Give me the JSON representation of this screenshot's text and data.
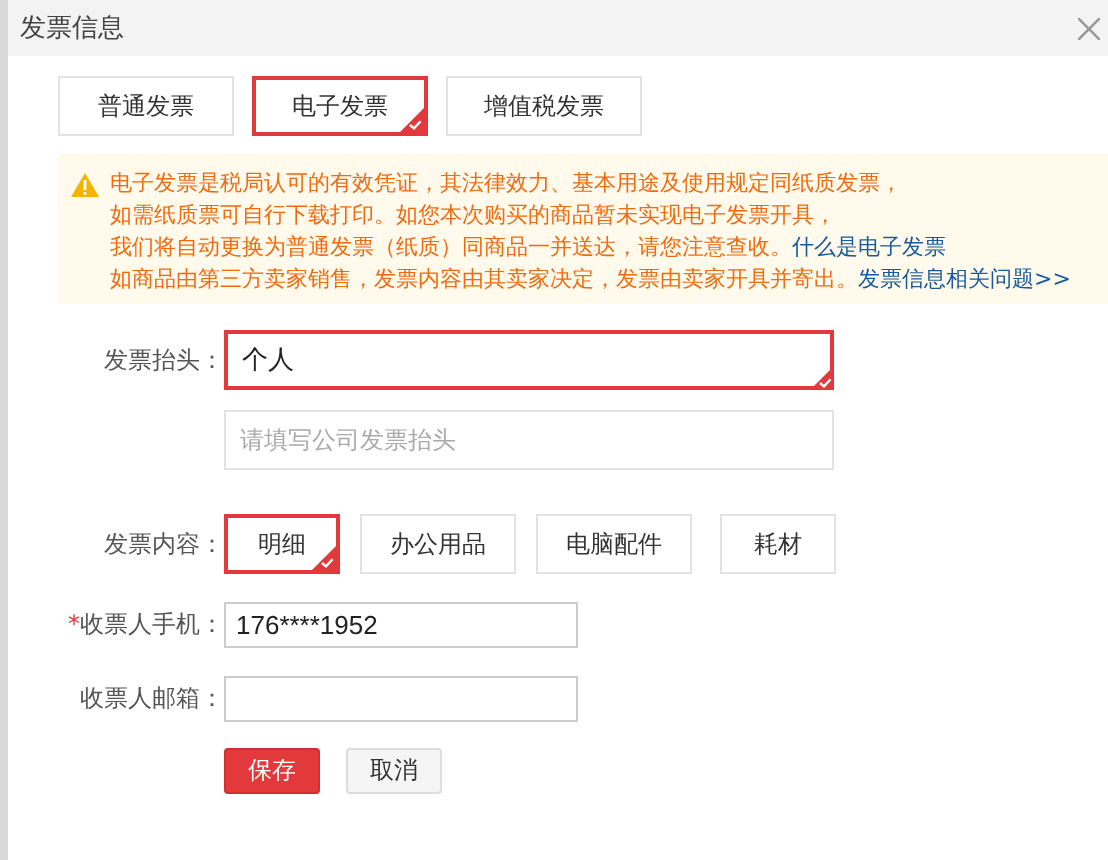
{
  "dialog": {
    "title": "发票信息"
  },
  "invoice_types": [
    {
      "label": "普通发票",
      "selected": false
    },
    {
      "label": "电子发票",
      "selected": true
    },
    {
      "label": "增值税发票",
      "selected": false
    }
  ],
  "notice": {
    "lines": [
      {
        "text": "电子发票是税局认可的有效凭证，其法律效力、基本用途及使用规定同纸质发票，"
      },
      {
        "text": "如需纸质票可自行下载打印。如您本次购买的商品暂未实现电子发票开具，"
      },
      {
        "text": "我们将自动更换为普通发票（纸质）同商品一并送达，请您注意查收。",
        "link": "什么是电子发票"
      },
      {
        "text": "如商品由第三方卖家销售，发票内容由其卖家决定，发票由卖家开具并寄出。",
        "link": "发票信息相关问题>>"
      }
    ]
  },
  "invoice_title": {
    "label": "发票抬头：",
    "value": "个人",
    "selected": true,
    "company_placeholder": "请填写公司发票抬头"
  },
  "invoice_content": {
    "label": "发票内容：",
    "options": [
      {
        "label": "明细",
        "selected": true
      },
      {
        "label": "办公用品",
        "selected": false
      },
      {
        "label": "电脑配件",
        "selected": false
      },
      {
        "label": "耗材",
        "selected": false
      }
    ]
  },
  "fields": [
    {
      "label": "收票人手机：",
      "required_mark": "*",
      "value": "176****1952"
    },
    {
      "label": "收票人邮箱："
    }
  ],
  "buttons": [
    {
      "label": "保存",
      "kind": "primary"
    },
    {
      "label": "取消",
      "kind": "secondary"
    }
  ]
}
